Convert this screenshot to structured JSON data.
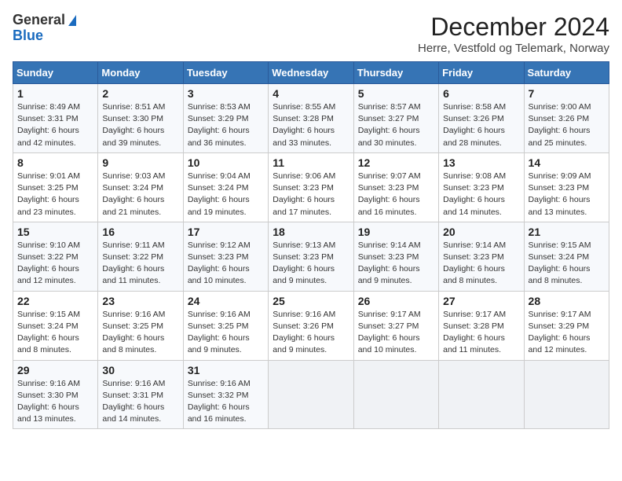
{
  "logo": {
    "line1": "General",
    "line2": "Blue"
  },
  "title": "December 2024",
  "subtitle": "Herre, Vestfold og Telemark, Norway",
  "days_of_week": [
    "Sunday",
    "Monday",
    "Tuesday",
    "Wednesday",
    "Thursday",
    "Friday",
    "Saturday"
  ],
  "weeks": [
    [
      {
        "day": 1,
        "info": "Sunrise: 8:49 AM\nSunset: 3:31 PM\nDaylight: 6 hours and 42 minutes."
      },
      {
        "day": 2,
        "info": "Sunrise: 8:51 AM\nSunset: 3:30 PM\nDaylight: 6 hours and 39 minutes."
      },
      {
        "day": 3,
        "info": "Sunrise: 8:53 AM\nSunset: 3:29 PM\nDaylight: 6 hours and 36 minutes."
      },
      {
        "day": 4,
        "info": "Sunrise: 8:55 AM\nSunset: 3:28 PM\nDaylight: 6 hours and 33 minutes."
      },
      {
        "day": 5,
        "info": "Sunrise: 8:57 AM\nSunset: 3:27 PM\nDaylight: 6 hours and 30 minutes."
      },
      {
        "day": 6,
        "info": "Sunrise: 8:58 AM\nSunset: 3:26 PM\nDaylight: 6 hours and 28 minutes."
      },
      {
        "day": 7,
        "info": "Sunrise: 9:00 AM\nSunset: 3:26 PM\nDaylight: 6 hours and 25 minutes."
      }
    ],
    [
      {
        "day": 8,
        "info": "Sunrise: 9:01 AM\nSunset: 3:25 PM\nDaylight: 6 hours and 23 minutes."
      },
      {
        "day": 9,
        "info": "Sunrise: 9:03 AM\nSunset: 3:24 PM\nDaylight: 6 hours and 21 minutes."
      },
      {
        "day": 10,
        "info": "Sunrise: 9:04 AM\nSunset: 3:24 PM\nDaylight: 6 hours and 19 minutes."
      },
      {
        "day": 11,
        "info": "Sunrise: 9:06 AM\nSunset: 3:23 PM\nDaylight: 6 hours and 17 minutes."
      },
      {
        "day": 12,
        "info": "Sunrise: 9:07 AM\nSunset: 3:23 PM\nDaylight: 6 hours and 16 minutes."
      },
      {
        "day": 13,
        "info": "Sunrise: 9:08 AM\nSunset: 3:23 PM\nDaylight: 6 hours and 14 minutes."
      },
      {
        "day": 14,
        "info": "Sunrise: 9:09 AM\nSunset: 3:23 PM\nDaylight: 6 hours and 13 minutes."
      }
    ],
    [
      {
        "day": 15,
        "info": "Sunrise: 9:10 AM\nSunset: 3:22 PM\nDaylight: 6 hours and 12 minutes."
      },
      {
        "day": 16,
        "info": "Sunrise: 9:11 AM\nSunset: 3:22 PM\nDaylight: 6 hours and 11 minutes."
      },
      {
        "day": 17,
        "info": "Sunrise: 9:12 AM\nSunset: 3:23 PM\nDaylight: 6 hours and 10 minutes."
      },
      {
        "day": 18,
        "info": "Sunrise: 9:13 AM\nSunset: 3:23 PM\nDaylight: 6 hours and 9 minutes."
      },
      {
        "day": 19,
        "info": "Sunrise: 9:14 AM\nSunset: 3:23 PM\nDaylight: 6 hours and 9 minutes."
      },
      {
        "day": 20,
        "info": "Sunrise: 9:14 AM\nSunset: 3:23 PM\nDaylight: 6 hours and 8 minutes."
      },
      {
        "day": 21,
        "info": "Sunrise: 9:15 AM\nSunset: 3:24 PM\nDaylight: 6 hours and 8 minutes."
      }
    ],
    [
      {
        "day": 22,
        "info": "Sunrise: 9:15 AM\nSunset: 3:24 PM\nDaylight: 6 hours and 8 minutes."
      },
      {
        "day": 23,
        "info": "Sunrise: 9:16 AM\nSunset: 3:25 PM\nDaylight: 6 hours and 8 minutes."
      },
      {
        "day": 24,
        "info": "Sunrise: 9:16 AM\nSunset: 3:25 PM\nDaylight: 6 hours and 9 minutes."
      },
      {
        "day": 25,
        "info": "Sunrise: 9:16 AM\nSunset: 3:26 PM\nDaylight: 6 hours and 9 minutes."
      },
      {
        "day": 26,
        "info": "Sunrise: 9:17 AM\nSunset: 3:27 PM\nDaylight: 6 hours and 10 minutes."
      },
      {
        "day": 27,
        "info": "Sunrise: 9:17 AM\nSunset: 3:28 PM\nDaylight: 6 hours and 11 minutes."
      },
      {
        "day": 28,
        "info": "Sunrise: 9:17 AM\nSunset: 3:29 PM\nDaylight: 6 hours and 12 minutes."
      }
    ],
    [
      {
        "day": 29,
        "info": "Sunrise: 9:16 AM\nSunset: 3:30 PM\nDaylight: 6 hours and 13 minutes."
      },
      {
        "day": 30,
        "info": "Sunrise: 9:16 AM\nSunset: 3:31 PM\nDaylight: 6 hours and 14 minutes."
      },
      {
        "day": 31,
        "info": "Sunrise: 9:16 AM\nSunset: 3:32 PM\nDaylight: 6 hours and 16 minutes."
      },
      null,
      null,
      null,
      null
    ]
  ]
}
